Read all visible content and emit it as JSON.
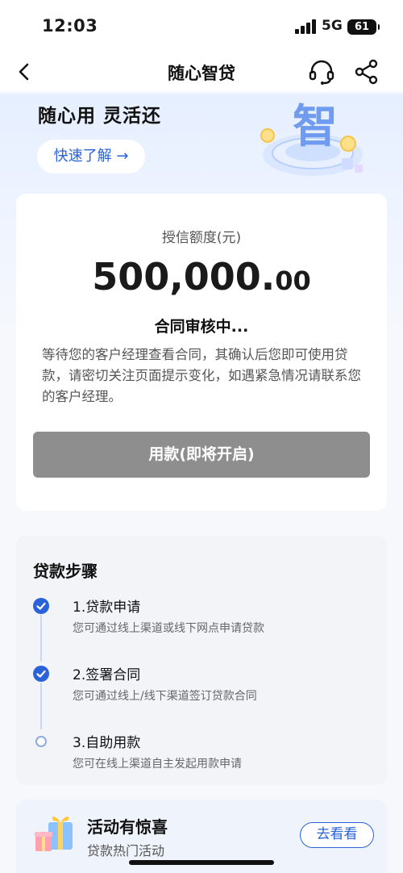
{
  "status_bar": {
    "time": "12:03",
    "network": "5G",
    "battery": "61"
  },
  "nav": {
    "title": "随心智贷",
    "icons": [
      "back-icon",
      "headset-icon",
      "share-icon"
    ]
  },
  "hero": {
    "title": "随心用 灵活还",
    "quick_link": "快速了解 →",
    "art_glyph": "智"
  },
  "credit": {
    "label": "授信额度(元)",
    "amount_int": "500,000.",
    "amount_dec": "00",
    "status": "合同审核中...",
    "description": "等待您的客户经理查看合同，其确认后您即可使用贷款，请密切关注页面提示变化，如遇紧急情况请联系您的客户经理。",
    "button": "用款(即将开启)"
  },
  "steps": {
    "title": "贷款步骤",
    "items": [
      {
        "title": "1.贷款申请",
        "subtitle": "您可通过线上渠道或线下网点申请贷款",
        "done": true
      },
      {
        "title": "2.签署合同",
        "subtitle": "您可通过线上/线下渠道签订贷款合同",
        "done": true
      },
      {
        "title": "3.自助用款",
        "subtitle": "您可在线上渠道自主发起用款申请",
        "done": false
      }
    ]
  },
  "promo": {
    "title": "活动有惊喜",
    "subtitle": "贷款热门活动",
    "button": "去看看"
  },
  "colors": {
    "accent": "#2a63d9",
    "disabled_button": "#8e8e8e",
    "hero_bg": "#e6efff"
  }
}
